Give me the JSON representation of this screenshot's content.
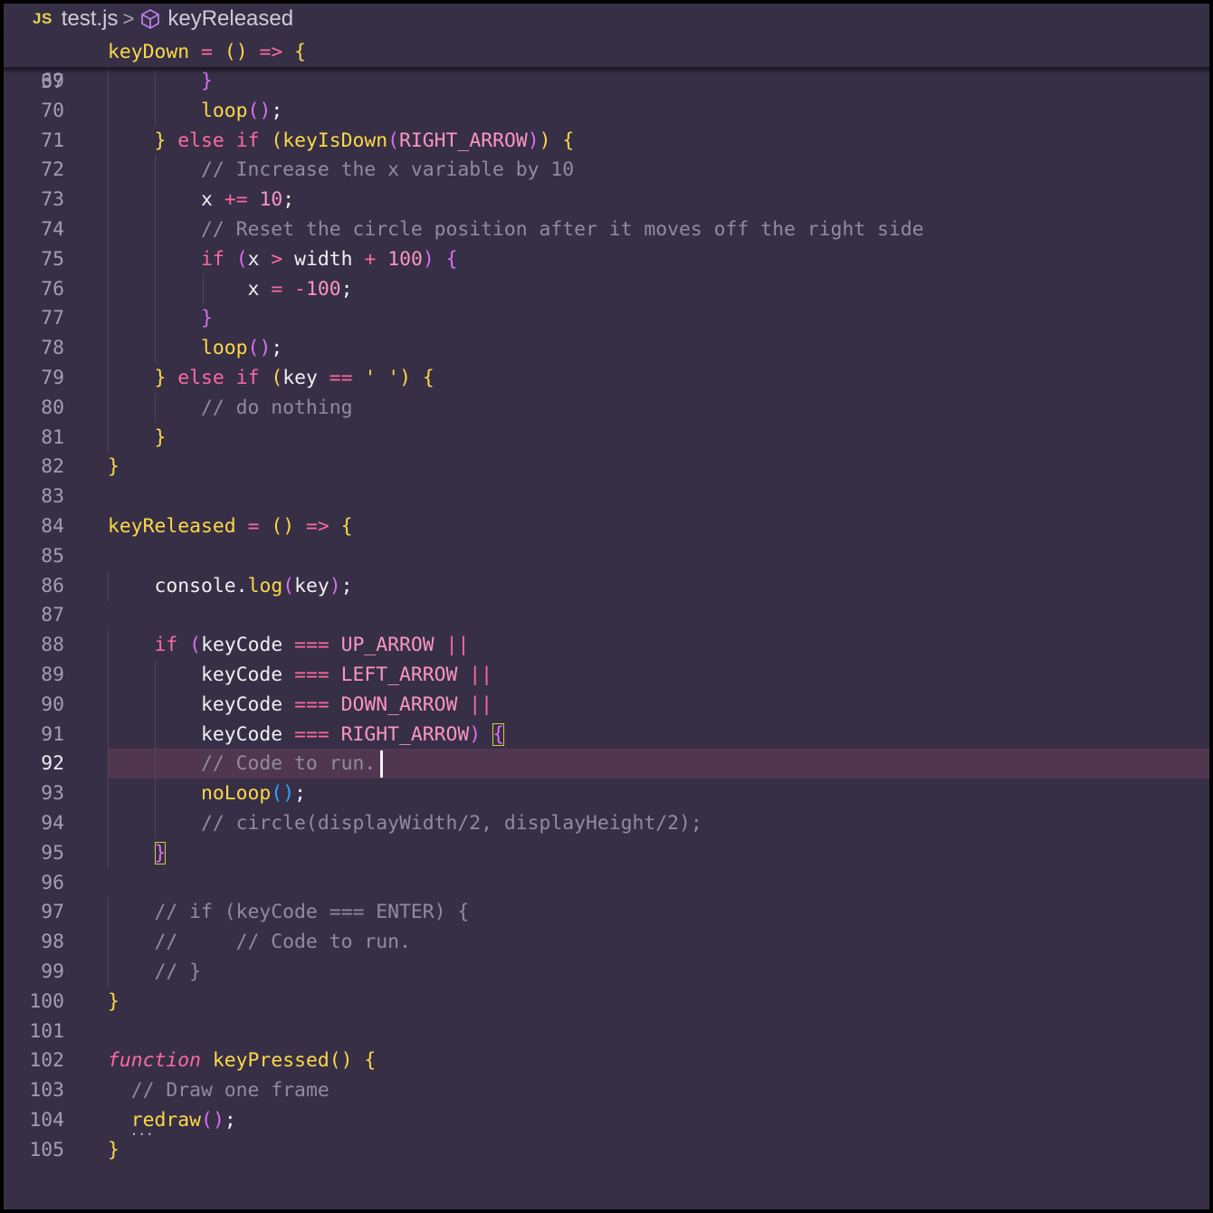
{
  "breadcrumb": {
    "lang_badge": "JS",
    "file": "test.js",
    "separator": ">",
    "symbol": "keyReleased"
  },
  "sticky": {
    "line_number": "37",
    "code": "keyDown = () => {"
  },
  "current_line": "92",
  "lines": [
    {
      "n": "69",
      "t": "        }"
    },
    {
      "n": "70",
      "t": "        loop();"
    },
    {
      "n": "71",
      "t": "    } else if (keyIsDown(RIGHT_ARROW)) {"
    },
    {
      "n": "72",
      "t": "        // Increase the x variable by 10"
    },
    {
      "n": "73",
      "t": "        x += 10;"
    },
    {
      "n": "74",
      "t": "        // Reset the circle position after it moves off the right side"
    },
    {
      "n": "75",
      "t": "        if (x > width + 100) {"
    },
    {
      "n": "76",
      "t": "            x = -100;"
    },
    {
      "n": "77",
      "t": "        }"
    },
    {
      "n": "78",
      "t": "        loop();"
    },
    {
      "n": "79",
      "t": "    } else if (key == ' ') {"
    },
    {
      "n": "80",
      "t": "        // do nothing"
    },
    {
      "n": "81",
      "t": "    }"
    },
    {
      "n": "82",
      "t": "}"
    },
    {
      "n": "83",
      "t": ""
    },
    {
      "n": "84",
      "t": "keyReleased = () => {"
    },
    {
      "n": "85",
      "t": ""
    },
    {
      "n": "86",
      "t": "    console.log(key);"
    },
    {
      "n": "87",
      "t": ""
    },
    {
      "n": "88",
      "t": "    if (keyCode === UP_ARROW ||"
    },
    {
      "n": "89",
      "t": "        keyCode === LEFT_ARROW ||"
    },
    {
      "n": "90",
      "t": "        keyCode === DOWN_ARROW ||"
    },
    {
      "n": "91",
      "t": "        keyCode === RIGHT_ARROW) {"
    },
    {
      "n": "92",
      "t": "        // Code to run."
    },
    {
      "n": "93",
      "t": "        noLoop();"
    },
    {
      "n": "94",
      "t": "        // circle(displayWidth/2, displayHeight/2);"
    },
    {
      "n": "95",
      "t": "    }"
    },
    {
      "n": "96",
      "t": ""
    },
    {
      "n": "97",
      "t": "    // if (keyCode === ENTER) {"
    },
    {
      "n": "98",
      "t": "    //     // Code to run."
    },
    {
      "n": "99",
      "t": "    // }"
    },
    {
      "n": "100",
      "t": "}"
    },
    {
      "n": "101",
      "t": ""
    },
    {
      "n": "102",
      "t": "function keyPressed() {"
    },
    {
      "n": "103",
      "t": "  // Draw one frame"
    },
    {
      "n": "104",
      "t": "  redraw();"
    },
    {
      "n": "105",
      "t": "}"
    }
  ],
  "colors": {
    "background": "#372f45",
    "keyword": "#fb6aa3",
    "function": "#fcd849",
    "comment": "#928ba0",
    "bracket_level_2": "#d870f0",
    "bracket_level_3": "#35a3ff",
    "current_line_highlight": "#51364f"
  }
}
